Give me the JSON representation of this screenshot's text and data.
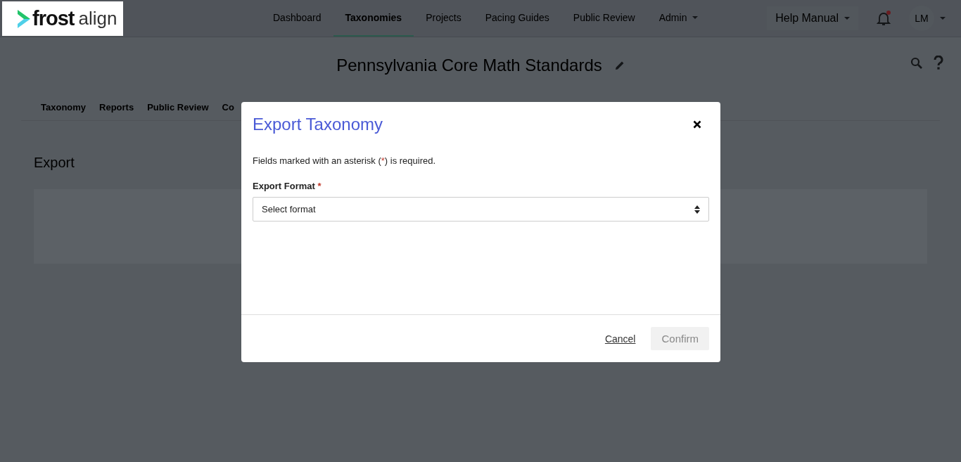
{
  "logo": {
    "brand": "frost",
    "product": "align"
  },
  "nav": [
    {
      "label": "Dashboard",
      "selected": false,
      "has_menu": false
    },
    {
      "label": "Taxonomies",
      "selected": true,
      "has_menu": false
    },
    {
      "label": "Projects",
      "selected": false,
      "has_menu": false
    },
    {
      "label": "Pacing Guides",
      "selected": false,
      "has_menu": false
    },
    {
      "label": "Public Review",
      "selected": false,
      "has_menu": false
    },
    {
      "label": "Admin",
      "selected": false,
      "has_menu": true
    }
  ],
  "help": {
    "label": "Help Manual"
  },
  "notifications": {
    "unread": true
  },
  "user": {
    "initials": "LM"
  },
  "page_title": "Pennsylvania Core Math Standards",
  "subtabs": [
    {
      "label": "Taxonomy"
    },
    {
      "label": "Reports"
    },
    {
      "label": "Public Review"
    },
    {
      "label": "Co"
    }
  ],
  "section_title": "Export",
  "modal": {
    "title": "Export Taxonomy",
    "note": {
      "before": "Fields marked with an asterisk (",
      "mark": "*",
      "after": ") is required."
    },
    "field": {
      "label": "Export Format",
      "required": true,
      "placeholder": "Select format"
    },
    "cancel": "Cancel",
    "confirm": {
      "label": "Confirm",
      "disabled": true
    }
  }
}
